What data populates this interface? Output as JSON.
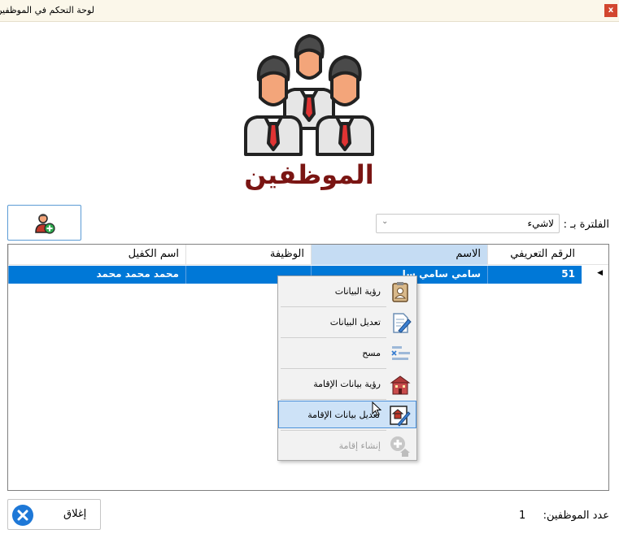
{
  "window": {
    "title": "لوحة التحكم في الموظفين",
    "close_glyph": "x"
  },
  "page": {
    "title": "الموظفين"
  },
  "filter": {
    "label": "الفلترة بـ :",
    "selected": "لاشيء"
  },
  "table": {
    "columns": [
      "الرقم التعريفي",
      "الاسم",
      "الوظيفة",
      "اسم الكفيل"
    ],
    "rows": [
      {
        "id": "51",
        "name": "سامي سامي  سا",
        "job": "",
        "sponsor": "محمد محمد  محمد"
      }
    ]
  },
  "context_menu": {
    "items": [
      {
        "label": "رؤية البيانات",
        "icon": "id-card-icon"
      },
      {
        "label": "تعديل البيانات",
        "icon": "edit-document-icon"
      },
      {
        "label": "مسح",
        "icon": "delete-list-icon"
      },
      {
        "label": "رؤية بيانات الإقامة",
        "icon": "building-icon"
      },
      {
        "label": "تعديل بيانات الإقامة",
        "icon": "edit-residence-icon"
      },
      {
        "label": "إنشاء إقامة",
        "icon": "add-residence-icon"
      }
    ]
  },
  "footer": {
    "count_label": "عدد الموظفين:",
    "count_value": "1",
    "close_label": "إغلاق"
  },
  "colors": {
    "title": "#7a1513",
    "selection": "#0078d7",
    "accent": "#5b9bd5"
  }
}
